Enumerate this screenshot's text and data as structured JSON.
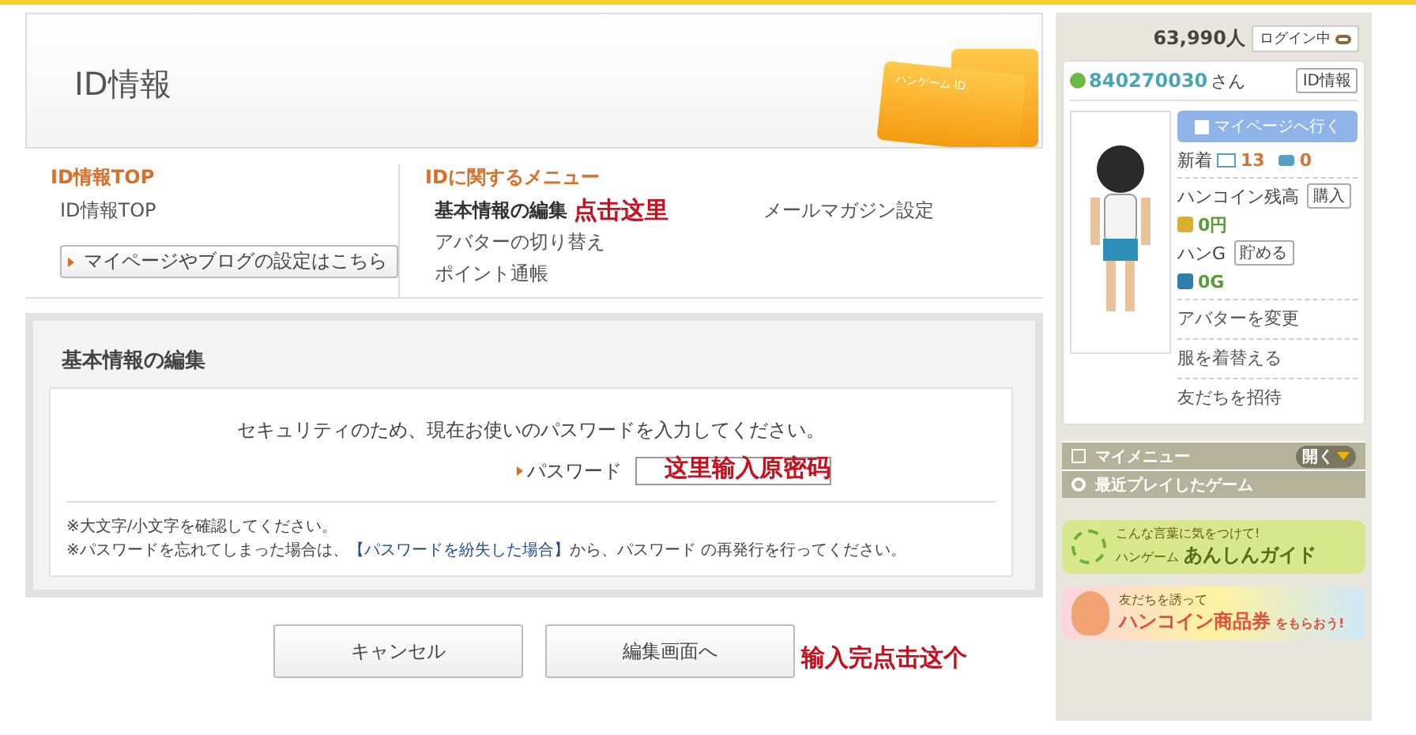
{
  "header": {
    "title": "ID情報",
    "card_label": "ハンゲーム ID"
  },
  "left_menu": {
    "heading": "ID情報TOP",
    "items": [
      {
        "label": "ID情報TOP"
      }
    ],
    "button": "マイページやブログの設定はこちら"
  },
  "id_menu": {
    "heading": "IDに関するメニュー",
    "annotation": "点击这里",
    "items": [
      {
        "label": "基本情報の編集",
        "selected": true
      },
      {
        "label": "アバターの切り替え",
        "selected": false
      },
      {
        "label": "ポイント通帳",
        "selected": false
      },
      {
        "label": "メールマガジン設定",
        "selected": false
      }
    ]
  },
  "form": {
    "title": "基本情報の編集",
    "instruction": "セキュリティのため、現在お使いのパスワードを入力してください。",
    "password_label": "パスワード",
    "password_annotation": "这里输入原密码",
    "note_1": "※大文字/小文字を確認してください。",
    "note_2": {
      "before": "※パスワードを忘れてしまった場合は、",
      "link": "【パスワードを紛失した場合】",
      "after": "から、パスワード の再発行を行ってください。"
    }
  },
  "buttons": [
    {
      "label": "キャンセル"
    },
    {
      "label": "編集画面へ"
    }
  ],
  "button_annotation": "输入完点击这个",
  "sidebar": {
    "user_count": "63,990人",
    "login_status": "ログイン中",
    "user_name": "840270030",
    "honorific": "さん",
    "id_info_button": "ID情報",
    "mypage_button": "マイページへ行く",
    "new_label": "新着",
    "mail_count": "13",
    "comment_count": "0",
    "coin_label": "ハンコイン残高",
    "buy_button": "購入",
    "coin_balance": "0円",
    "hang_label": "ハンG",
    "save_button": "貯める",
    "hang_balance": "0G",
    "links": [
      "アバターを変更",
      "服を着替える",
      "友だちを招待"
    ],
    "my_menu": "マイメニュー",
    "open_button": "開く",
    "recent_games": "最近プレイしたゲーム",
    "banners": [
      {
        "kind": "guide",
        "lines": [
          "こんな言葉に気をつけて!",
          "ハンゲーム",
          "あんしんガイド"
        ]
      },
      {
        "kind": "invite",
        "lines": [
          "友だちを誘って",
          "ハンコイン商品券",
          "をもらおう!"
        ]
      }
    ]
  }
}
